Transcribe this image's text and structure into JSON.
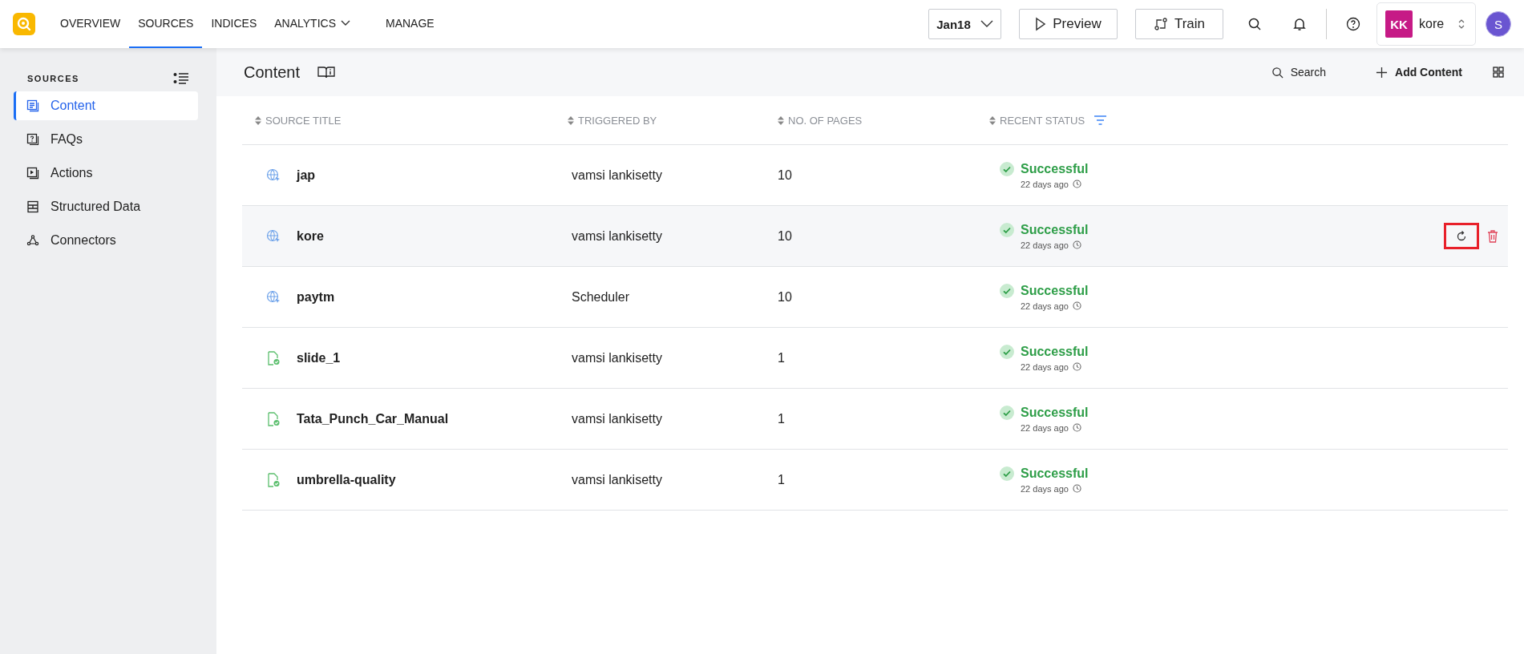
{
  "nav": {
    "tabs": [
      {
        "label": "OVERVIEW",
        "selected": false,
        "kind": "link"
      },
      {
        "label": "SOURCES",
        "selected": true,
        "kind": "link"
      },
      {
        "label": "INDICES",
        "selected": false,
        "kind": "link"
      },
      {
        "label": "ANALYTICS",
        "selected": false,
        "kind": "menu"
      },
      {
        "label": "MANAGE",
        "selected": false,
        "kind": "link"
      }
    ],
    "version": "Jan18",
    "preview": "Preview",
    "train": "Train",
    "account": {
      "initials": "KK",
      "name": "kore"
    },
    "avatar": "S"
  },
  "sidebar": {
    "title": "SOURCES",
    "items": [
      {
        "label": "Content",
        "selected": true
      },
      {
        "label": "FAQs",
        "selected": false
      },
      {
        "label": "Actions",
        "selected": false
      },
      {
        "label": "Structured Data",
        "selected": false
      },
      {
        "label": "Connectors",
        "selected": false
      }
    ]
  },
  "header": {
    "title": "Content",
    "search": "Search",
    "add": "Add Content"
  },
  "table": {
    "columns": [
      "SOURCE TITLE",
      "TRIGGERED BY",
      "NO. OF PAGES",
      "RECENT STATUS"
    ],
    "rows": [
      {
        "kind": "web",
        "title": "jap",
        "triggered_by": "vamsi lankisetty",
        "pages": "10",
        "status": "Successful",
        "time": "22 days ago",
        "hovered": false
      },
      {
        "kind": "web",
        "title": "kore",
        "triggered_by": "vamsi lankisetty",
        "pages": "10",
        "status": "Successful",
        "time": "22 days ago",
        "hovered": true
      },
      {
        "kind": "web",
        "title": "paytm",
        "triggered_by": "Scheduler",
        "pages": "10",
        "status": "Successful",
        "time": "22 days ago",
        "hovered": false
      },
      {
        "kind": "file",
        "title": "slide_1",
        "triggered_by": "vamsi lankisetty",
        "pages": "1",
        "status": "Successful",
        "time": "22 days ago",
        "hovered": false
      },
      {
        "kind": "file",
        "title": "Tata_Punch_Car_Manual",
        "triggered_by": "vamsi lankisetty",
        "pages": "1",
        "status": "Successful",
        "time": "22 days ago",
        "hovered": false
      },
      {
        "kind": "file",
        "title": "umbrella-quality",
        "triggered_by": "vamsi lankisetty",
        "pages": "1",
        "status": "Successful",
        "time": "22 days ago",
        "hovered": false
      }
    ]
  }
}
